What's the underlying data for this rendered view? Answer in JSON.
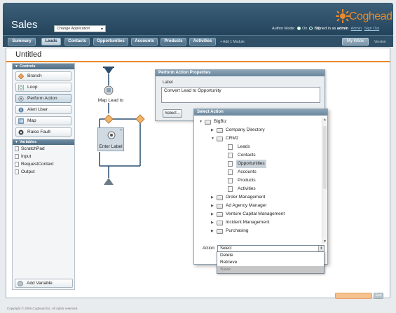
{
  "header": {
    "app_title": "Sales",
    "app_selector": "Change Application",
    "logo_text": "Coghead",
    "author_mode_label": "Author Mode:",
    "author_on": "On",
    "author_off": "Off",
    "signed_in_label": "Signed in as",
    "user": "admin",
    "admin_link": "Admin",
    "signout_link": "Sign Out",
    "brand_color": "#e88a2c"
  },
  "nav": {
    "tabs": [
      {
        "label": "Summary",
        "active": false
      },
      {
        "label": "Leads",
        "active": true
      },
      {
        "label": "Contacts",
        "active": false
      },
      {
        "label": "Opportunities",
        "active": false
      },
      {
        "label": "Accounts",
        "active": false
      },
      {
        "label": "Products",
        "active": false
      },
      {
        "label": "Activities",
        "active": false
      }
    ],
    "add_module": "+ Add 1 Module",
    "inbox": "My Inbox",
    "version": "Version"
  },
  "doc": {
    "title": "Untitled"
  },
  "palette": {
    "controls_header": "Controls",
    "controls": [
      {
        "label": "Branch",
        "icon": "branch-icon"
      },
      {
        "label": "Loop",
        "icon": "loop-icon"
      },
      {
        "label": "Perform Action",
        "icon": "gear-icon",
        "selected": true
      },
      {
        "label": "Alert User",
        "icon": "alert-icon"
      },
      {
        "label": "Map",
        "icon": "map-icon"
      },
      {
        "label": "Raise Fault",
        "icon": "fault-icon"
      }
    ],
    "variables_header": "Variables",
    "variables": [
      "ScratchPad",
      "Input",
      "RequestContext",
      "Output"
    ],
    "add_variable": "Add Variable"
  },
  "flow": {
    "nodes": [
      "Map Lead to",
      "Enter Label"
    ]
  },
  "perform_action_dialog": {
    "title": "Perform Action Properties",
    "label_caption": "Label",
    "label_value": "Convert Lead to Opportunity",
    "select_button": "Select..."
  },
  "select_action_dialog": {
    "title": "Select Action",
    "tree": [
      {
        "label": "BigBiz",
        "level": 0,
        "type": "folder",
        "expanded": true
      },
      {
        "label": "Company Directory",
        "level": 1,
        "type": "folder",
        "expanded": false
      },
      {
        "label": "CRM2",
        "level": 1,
        "type": "folder",
        "expanded": true
      },
      {
        "label": "Leads",
        "level": 2,
        "type": "doc"
      },
      {
        "label": "Contacts",
        "level": 2,
        "type": "doc"
      },
      {
        "label": "Opportunities",
        "level": 2,
        "type": "doc",
        "selected": true
      },
      {
        "label": "Accounts",
        "level": 2,
        "type": "doc"
      },
      {
        "label": "Products",
        "level": 2,
        "type": "doc"
      },
      {
        "label": "Activities",
        "level": 2,
        "type": "doc"
      },
      {
        "label": "Order Management",
        "level": 1,
        "type": "folder",
        "expanded": false
      },
      {
        "label": "Ad Agency Manager",
        "level": 1,
        "type": "folder",
        "expanded": false
      },
      {
        "label": "Venture Capital Management",
        "level": 1,
        "type": "folder",
        "expanded": false
      },
      {
        "label": "Incident Management",
        "level": 1,
        "type": "folder",
        "expanded": false
      },
      {
        "label": "Purchasing",
        "level": 1,
        "type": "folder",
        "expanded": false
      }
    ],
    "action_label": "Action:",
    "action_value": "Select",
    "options": [
      {
        "label": "Delete",
        "disabled": false
      },
      {
        "label": "Retrieve",
        "disabled": false
      },
      {
        "label": "Save",
        "disabled": true
      }
    ]
  },
  "footer": {
    "exit": "Exit",
    "copyright": "Copyright © 2006 Coghead Inc. All rights reserved."
  }
}
